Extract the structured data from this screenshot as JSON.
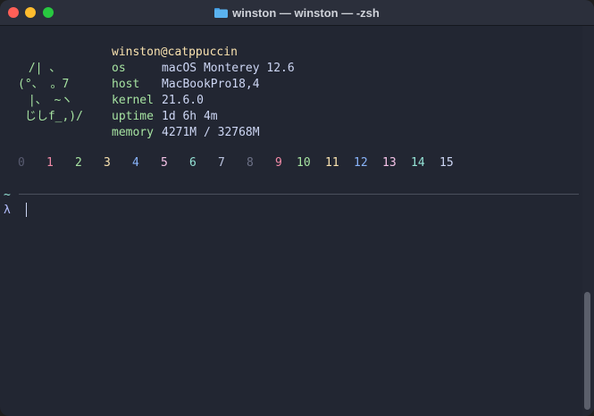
{
  "window": {
    "title": "winston — winston — -zsh"
  },
  "fetch": {
    "userhost": {
      "user": "winston",
      "at": "@",
      "host": "catppuccin"
    },
    "fields": [
      {
        "key": "os",
        "value": "macOS Monterey 12.6"
      },
      {
        "key": "host",
        "value": "MacBookPro18,4"
      },
      {
        "key": "kernel",
        "value": "21.6.0"
      },
      {
        "key": "uptime",
        "value": "1d 6h 4m"
      },
      {
        "key": "memory",
        "value": "4271M / 32768M"
      }
    ],
    "art": [
      " /| 、",
      "(°、 。7",
      " |、 ~ヽ",
      " じしf_,)/"
    ]
  },
  "palette": [
    {
      "label": "0",
      "color": "#585b70"
    },
    {
      "label": "1",
      "color": "#f38ba8"
    },
    {
      "label": "2",
      "color": "#a6e3a1"
    },
    {
      "label": "3",
      "color": "#f9e2af"
    },
    {
      "label": "4",
      "color": "#89b4fa"
    },
    {
      "label": "5",
      "color": "#f5c2e7"
    },
    {
      "label": "6",
      "color": "#94e2d5"
    },
    {
      "label": "7",
      "color": "#bac2de"
    },
    {
      "label": "8",
      "color": "#6c7086"
    },
    {
      "label": "9",
      "color": "#f38ba8"
    },
    {
      "label": "10",
      "color": "#a6e3a1"
    },
    {
      "label": "11",
      "color": "#f9e2af"
    },
    {
      "label": "12",
      "color": "#89b4fa"
    },
    {
      "label": "13",
      "color": "#f5c2e7"
    },
    {
      "label": "14",
      "color": "#94e2d5"
    },
    {
      "label": "15",
      "color": "#cdd6f4"
    }
  ],
  "prompt": {
    "cwd": "~",
    "symbol": "λ"
  },
  "colors": {
    "key": "#a6e3a1",
    "value": "#cdd6f4",
    "user": "#f9e2af",
    "art": "#a6e3a1",
    "cwd": "#94e2d5",
    "prompt": "#b4befe"
  }
}
